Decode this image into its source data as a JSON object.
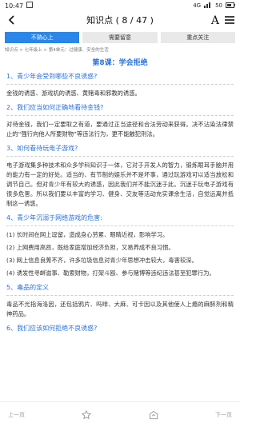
{
  "status": {
    "time": "10:47",
    "network": "4G",
    "battery": "50"
  },
  "header": {
    "title": "知识点 ( 8 / 47 )"
  },
  "tabs": [
    {
      "label": "不熟心上",
      "active": true
    },
    {
      "label": "需要留意",
      "active": false
    },
    {
      "label": "重点关注",
      "active": false
    }
  ],
  "breadcrumb": "知识点 > 七年级上 > 第4单元：过健康、安全的生活",
  "lesson_title": "第8课：学会拒绝",
  "sections": [
    {
      "q": "1、青少年会受到哪些不良诱惑?",
      "paras": [
        "金钱的诱惑、游戏机的诱惑、黄赌毒和邪教的诱惑。"
      ]
    },
    {
      "q": "2、我们应当如何正确地看待金钱?",
      "paras": [
        "对待金钱，我们一定要取之有道，要通过正当途径和合法劳动来获得。决不沾染法律禁止的“强行向他人所要财物”等违法行为，更不能触犯刑法。"
      ]
    },
    {
      "q": "3、如何看待玩电子游戏?",
      "paras": [
        "电子游戏集多种技术和众多学科知识于一体，它对于开发人的智力，锻炼眼耳手脑并用的能力有一定的好处。适当的、有节制的娱乐并不是坏事，通过玩游戏可以适当放松和调节自己。但对青少年有较大的诱惑，因此我们并不能沉迷于此。沉迷于玩电子游戏有很多危害。所以我们要以丰富的学习、健身、交友等活动充实课余生活，自觉远离并抵制这一诱惑。"
      ]
    },
    {
      "q": "4、青少年沉溺于网络游戏的危害:",
      "paras": [
        "(1) 长时间在网上逗留，造成身心劳累、眼睛近视，影响学习。",
        "(2) 上网费用高昂，既给家庭增加经济负担，又易养成不良习惯。",
        "(3) 网上信息良莠不齐，许多垃圾信息对青少年思想冲击较大，毒害较深。",
        "(4) 诱发性寻衅滋事、勒索财物，打架斗殴、参与赌博等违纪违法甚至犯罪行为。"
      ]
    },
    {
      "q": "5、毒品的定义",
      "paras": [
        "毒品不光指海洛因，还包括鸦片、吗啡、大麻、可卡因以及其他使人上瘾的麻醉剂和精神药品。"
      ]
    },
    {
      "q": "6、我们应该如何拒绝不良诱惑?",
      "paras": []
    }
  ],
  "bottom": {
    "prev": "上一页",
    "next": "下一页"
  }
}
